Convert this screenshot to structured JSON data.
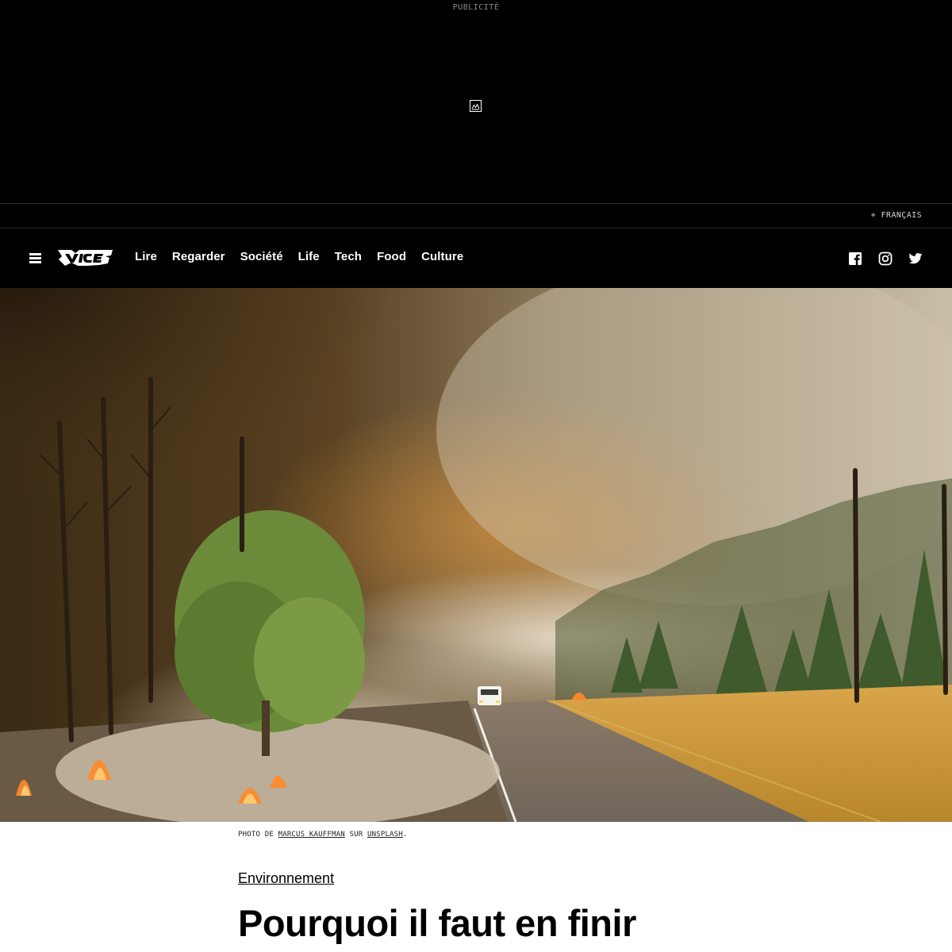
{
  "ad": {
    "label": "PUBLICITÉ",
    "icon": "image-placeholder-icon"
  },
  "language": {
    "label": "+ FRANÇAIS"
  },
  "nav": {
    "menu_icon": "hamburger-menu-icon",
    "logo": "VICE",
    "links": [
      "Lire",
      "Regarder",
      "Société",
      "Life",
      "Tech",
      "Food",
      "Culture"
    ],
    "social": [
      "facebook-icon",
      "instagram-icon",
      "twitter-icon"
    ]
  },
  "hero": {
    "description": "wildfire-photo"
  },
  "caption": {
    "prefix": "PHOTO DE",
    "author": "MARCUS KAUFFMAN",
    "middle": "SUR",
    "source": "UNSPLASH",
    "suffix": "."
  },
  "article": {
    "category": "Environnement",
    "headline": "Pourquoi il faut en finir"
  },
  "colors": {
    "header_bg": "#000000",
    "nav_text": "#ffffff",
    "body_bg": "#ffffff"
  }
}
